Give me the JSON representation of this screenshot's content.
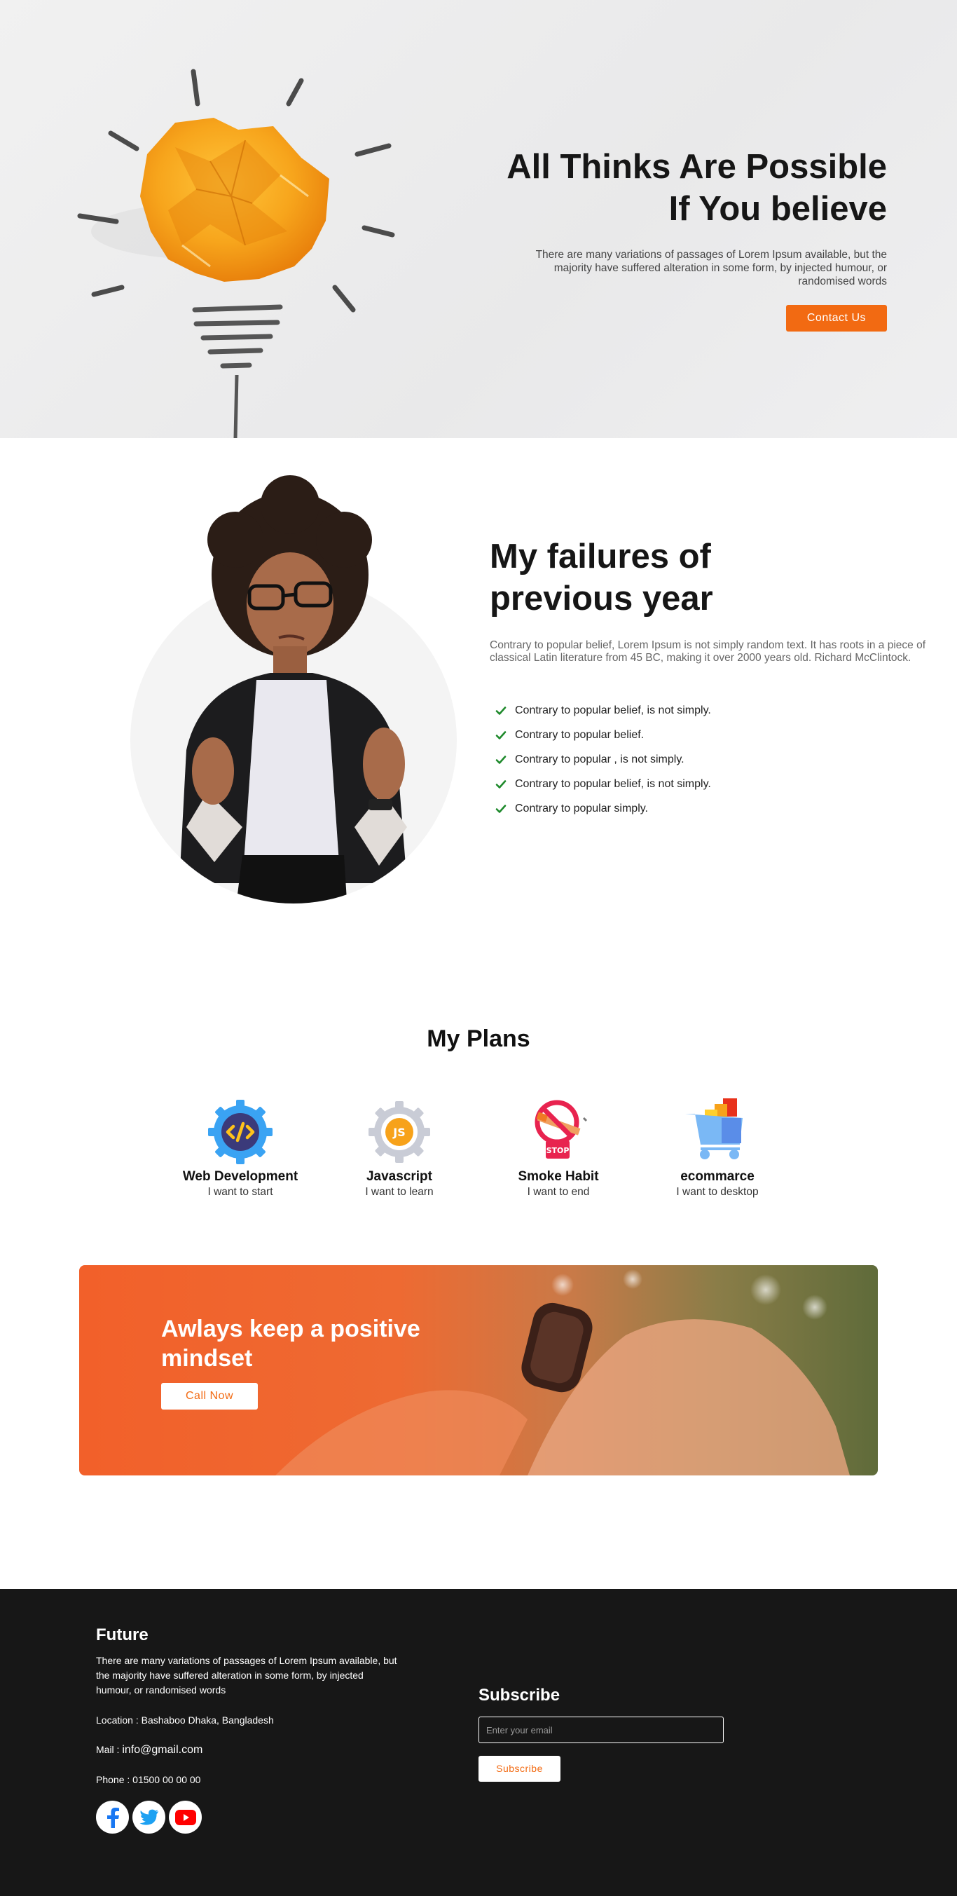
{
  "hero": {
    "title_line1": "All Thinks Are Possible",
    "title_line2": "If You believe",
    "description": "There are many variations of passages of Lorem Ipsum available, but the majority have suffered alteration in some form, by injected humour, or randomised words",
    "cta_label": "Contact Us"
  },
  "failures": {
    "title_line1": "My failures of",
    "title_line2": "previous year",
    "description": "Contrary to popular belief, Lorem Ipsum is not simply random text. It has roots in a piece of classical Latin literature from 45 BC, making it over 2000 years old. Richard McClintock.",
    "items": [
      "Contrary to popular belief, is not simply.",
      "Contrary to popular belief.",
      "Contrary to popular , is not simply.",
      "Contrary to popular belief, is not simply.",
      "Contrary to popular simply."
    ]
  },
  "plans": {
    "title": "My Plans",
    "items": [
      {
        "name": "Web Development",
        "sub": "I want to start",
        "icon": "code-gear-icon"
      },
      {
        "name": "Javascript",
        "sub": "I want to learn",
        "icon": "js-gear-icon"
      },
      {
        "name": "Smoke Habit",
        "sub": "I want to end",
        "icon": "no-smoking-stop-icon"
      },
      {
        "name": "ecommarce",
        "sub": "I want to desktop",
        "icon": "shopping-cart-icon"
      }
    ]
  },
  "cta": {
    "title": "Awlays keep a positive mindset",
    "button": "Call Now"
  },
  "footer": {
    "title": "Future",
    "description": "There are many variations of passages of Lorem Ipsum available, but the majority have suffered alteration in some form, by injected humour, or randomised words",
    "location": "Location : Bashaboo Dhaka, Bangladesh",
    "mail_label": "Mail : ",
    "mail_value": "info@gmail.com",
    "phone": "Phone : 01500 00 00 00",
    "subscribe_title": "Subscribe",
    "email_placeholder": "Enter your email",
    "subscribe_button": "Subscribe"
  },
  "colors": {
    "accent": "#f26a12",
    "footer_bg": "#171717",
    "check_green": "#1f8a2c",
    "facebook": "#1877f2",
    "twitter": "#1da1f2",
    "youtube": "#ff0000"
  }
}
